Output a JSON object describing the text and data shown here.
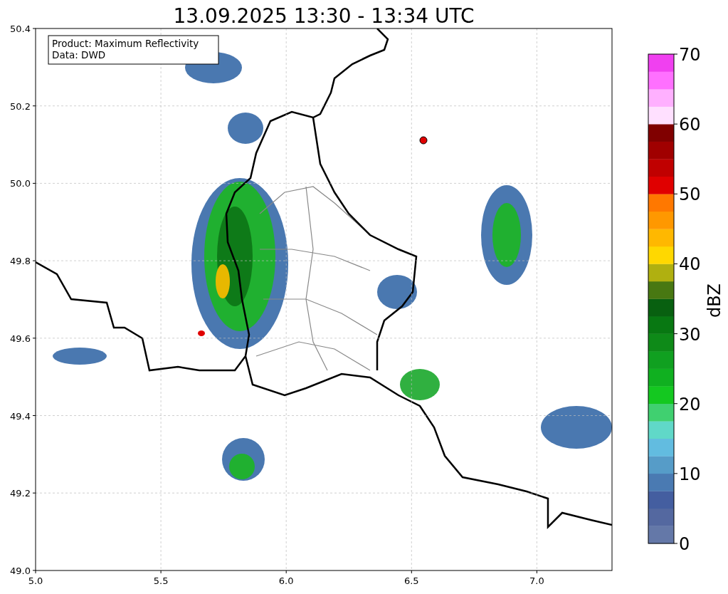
{
  "title": "13.09.2025 13:30 - 13:34 UTC",
  "info_box": {
    "lines": [
      "Product: Maximum Reflectivity",
      "Data: DWD"
    ]
  },
  "map": {
    "x_ticks": [
      "5.0",
      "5.5",
      "6.0",
      "6.5",
      "7.0"
    ],
    "y_ticks": [
      "50.4",
      "50.2",
      "50.0",
      "49.8",
      "49.6",
      "49.4",
      "49.2",
      "49.0"
    ]
  },
  "colorbar": {
    "label": "dBZ",
    "ticks": [
      "70",
      "60",
      "50",
      "40",
      "30",
      "20",
      "10",
      "0"
    ],
    "bins": [
      {
        "color": "#6478a8"
      },
      {
        "color": "#5468a0"
      },
      {
        "color": "#445ea0"
      },
      {
        "color": "#4a7ab2"
      },
      {
        "color": "#569cc8"
      },
      {
        "color": "#62bce0"
      },
      {
        "color": "#60d8c8"
      },
      {
        "color": "#40d070"
      },
      {
        "color": "#14c820"
      },
      {
        "color": "#10b020"
      },
      {
        "color": "#10a020"
      },
      {
        "color": "#0e8a18"
      },
      {
        "color": "#087812"
      },
      {
        "color": "#086010"
      },
      {
        "color": "#487812"
      },
      {
        "color": "#b0b010"
      },
      {
        "color": "#ffd800"
      },
      {
        "color": "#ffb800"
      },
      {
        "color": "#ff9800"
      },
      {
        "color": "#ff7800"
      },
      {
        "color": "#e00000"
      },
      {
        "color": "#c00000"
      },
      {
        "color": "#a00000"
      },
      {
        "color": "#800000"
      },
      {
        "color": "#ffe0ff"
      },
      {
        "color": "#ffb0ff"
      },
      {
        "color": "#ff70ff"
      },
      {
        "color": "#f040f0"
      }
    ]
  }
}
